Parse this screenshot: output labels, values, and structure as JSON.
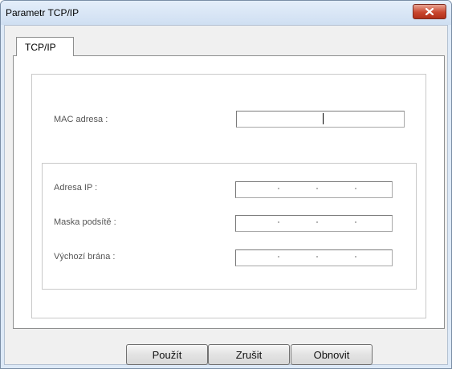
{
  "window": {
    "title": "Parametr TCP/IP",
    "close_icon": "close-icon"
  },
  "tabs": [
    {
      "label": "TCP/IP",
      "selected": true
    }
  ],
  "form": {
    "mac_label": "MAC adresa :",
    "mac_value": "",
    "ip_label": "Adresa IP :",
    "ip_value": "",
    "mask_label": "Maska podsítě :",
    "mask_value": "",
    "gateway_label": "Výchozí brána :",
    "gateway_value": ""
  },
  "buttons": {
    "apply": "Použít",
    "cancel": "Zrušit",
    "restore": "Obnovit"
  }
}
